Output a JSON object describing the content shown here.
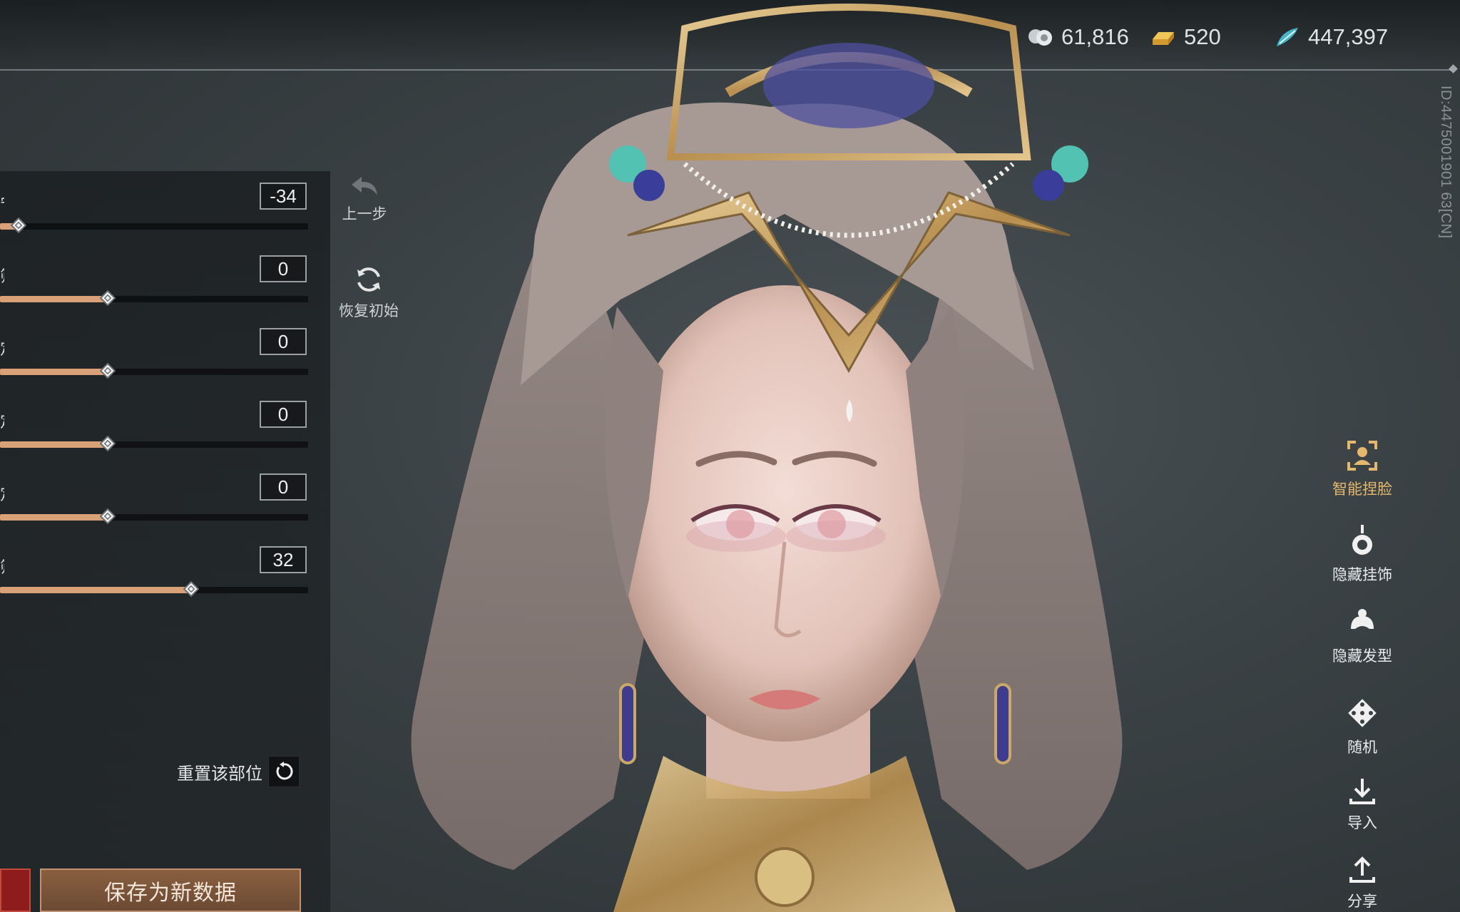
{
  "currencies": [
    {
      "icon": "coin-stack-icon",
      "value": "61,816"
    },
    {
      "icon": "gold-ingot-icon",
      "value": "520"
    },
    {
      "icon": "jade-feather-icon",
      "value": "447,397"
    }
  ],
  "player_id": "ID:4475001901 63[CN]",
  "sliders": [
    {
      "label": "宁",
      "value": "-34",
      "percent": 6
    },
    {
      "label": "筛",
      "value": "0",
      "percent": 35
    },
    {
      "label": "定",
      "value": "0",
      "percent": 35
    },
    {
      "label": "定",
      "value": "0",
      "percent": 35
    },
    {
      "label": "定",
      "value": "0",
      "percent": 35
    },
    {
      "label": "筛",
      "value": "32",
      "percent": 62
    }
  ],
  "history": {
    "undo_label": "上一步",
    "restore_label": "恢复初始"
  },
  "reset_part_label": "重置该部位",
  "save_label": "保存为新数据",
  "toolbar": [
    {
      "label": "智能捏脸",
      "icon": "face-scan-icon",
      "active": true
    },
    {
      "label": "隐藏挂饰",
      "icon": "ornament-icon",
      "active": false
    },
    {
      "label": "隐藏发型",
      "icon": "hairstyle-icon",
      "active": false
    },
    {
      "label": "随机",
      "icon": "dice-icon",
      "active": false
    },
    {
      "label": "导入",
      "icon": "import-icon",
      "active": false
    },
    {
      "label": "分享",
      "icon": "share-icon",
      "active": false
    }
  ],
  "colors": {
    "accent": "#d9a178",
    "active_tool": "#e5b86b",
    "save_button": "#7a5439"
  }
}
